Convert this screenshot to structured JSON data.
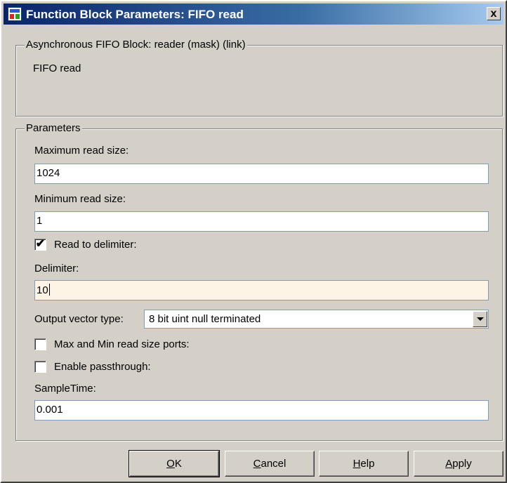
{
  "window": {
    "title": "Function Block Parameters: FIFO read",
    "close_glyph": "x"
  },
  "description_group": {
    "legend": "Asynchronous FIFO Block: reader (mask) (link)",
    "text": "FIFO read"
  },
  "parameters": {
    "legend": "Parameters",
    "max_read_size": {
      "label": "Maximum read size:",
      "value": "1024"
    },
    "min_read_size": {
      "label": "Minimum read size:",
      "value": "1"
    },
    "read_to_delimiter": {
      "label": "Read to delimiter:",
      "checked": true,
      "mark": "✔"
    },
    "delimiter": {
      "label": "Delimiter:",
      "value": "10"
    },
    "output_vector_type": {
      "label": "Output vector type:",
      "value": "8 bit uint null terminated"
    },
    "max_min_ports": {
      "label": "Max and Min read size ports:",
      "checked": false,
      "mark": ""
    },
    "enable_passthrough": {
      "label": "Enable passthrough:",
      "checked": false,
      "mark": ""
    },
    "sample_time": {
      "label": "SampleTime:",
      "value": "0.001"
    }
  },
  "buttons": {
    "ok": {
      "mnemonic": "O",
      "rest": "K"
    },
    "cancel": {
      "mnemonic": "C",
      "rest": "ancel"
    },
    "help": {
      "mnemonic": "H",
      "rest": "elp"
    },
    "apply": {
      "mnemonic": "A",
      "rest": "pply"
    }
  },
  "colors": {
    "face": "#d4d0c8",
    "title_start": "#0a246a",
    "title_end": "#a6caf0",
    "focused_field": "#fdf4e6"
  },
  "icons": {
    "title": "simulink-block-icon",
    "close": "close-icon",
    "dropdown": "chevron-down-icon",
    "check": "checkmark-icon"
  }
}
